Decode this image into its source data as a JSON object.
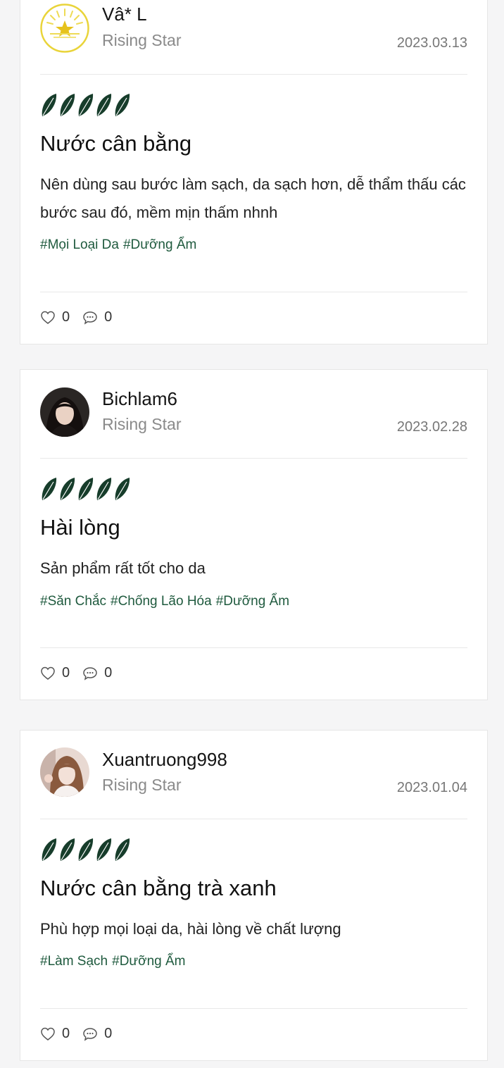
{
  "colors": {
    "leaf": "#173d2b",
    "tag": "#1f5a3e",
    "muted": "#8a8a8a",
    "background": "#f5f5f6"
  },
  "reviews": [
    {
      "username": "Vâ* L",
      "rank": "Rising Star",
      "date": "2023.03.13",
      "avatar_icon": "sun-logo-icon",
      "rating": 5,
      "title": "Nước cân bằng",
      "body": "Nên dùng sau bước làm sạch, da sạch hơn, dễ thẩm thấu các bước sau đó, mềm mịn thấm nhnh",
      "tags": [
        "#Mọi Loại Da",
        "#Dưỡng Ẩm"
      ],
      "likes": "0",
      "comments": "0"
    },
    {
      "username": "Bichlam6",
      "rank": "Rising Star",
      "date": "2023.02.28",
      "avatar_icon": "user-photo-icon",
      "rating": 5,
      "title": "Hài lòng",
      "body": "Sản phẩm rất tốt cho da",
      "tags": [
        "#Săn Chắc",
        "#Chống Lão Hóa",
        "#Dưỡng Ẩm"
      ],
      "likes": "0",
      "comments": "0"
    },
    {
      "username": "Xuantruong998",
      "rank": "Rising Star",
      "date": "2023.01.04",
      "avatar_icon": "user-photo-icon",
      "rating": 5,
      "title": "Nước cân bằng trà xanh",
      "body": "Phù hợp mọi loại da, hài lòng về chất lượng",
      "tags": [
        "#Làm Sạch",
        "#Dưỡng Ẩm"
      ],
      "likes": "0",
      "comments": "0"
    }
  ]
}
